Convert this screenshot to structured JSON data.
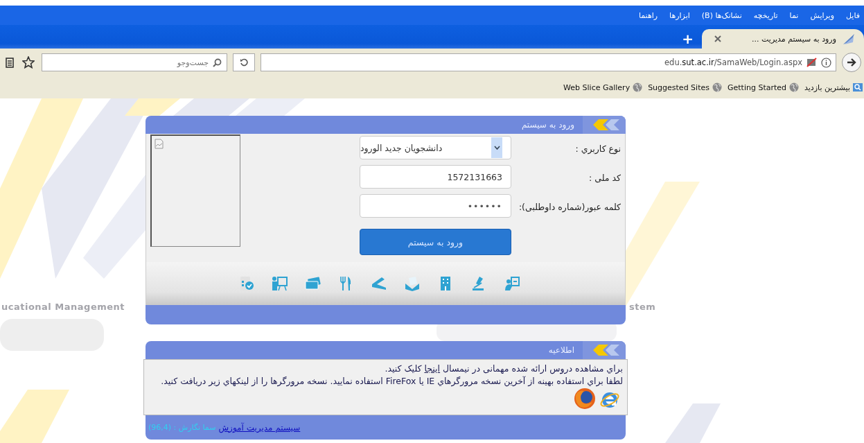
{
  "browser": {
    "menu": [
      "فایل",
      "ویرایش",
      "نما",
      "تاریخچه",
      "نشانک‌ها (B)",
      "ابزارها",
      "راهنما"
    ],
    "tabs": [
      {
        "title": "ورود به سیستم مدیریت ...",
        "selected": true
      }
    ],
    "new_tab": "+",
    "url": "edu.**sut.ac.ir**/SamaWeb/Login.aspx",
    "search": {
      "placeholder": "جست‌وجو"
    },
    "bookmarks": [
      {
        "label": "بیشترین بازدید",
        "kind": "folder"
      },
      {
        "label": "Getting Started",
        "kind": "site"
      },
      {
        "label": "Suggested Sites",
        "kind": "site"
      },
      {
        "label": "Web Slice Gallery",
        "kind": "site"
      }
    ]
  },
  "background": {
    "left_text": "ucational Management",
    "right_text": "stem"
  },
  "login": {
    "title": "ورود به سیستم",
    "fields": [
      {
        "kind": "select",
        "label": "نوع کاربري :",
        "value": "دانشجویان جدید الورود"
      },
      {
        "kind": "text",
        "label": "کد ملی :",
        "value": "1572131663"
      },
      {
        "kind": "password",
        "label": "کلمه عبور(شماره داوطلبی):",
        "value": "••••••"
      }
    ],
    "button": "ورود به سیستم"
  },
  "info": {
    "title": "اطلاعیه",
    "line1": "براي مشاهده دروس ارائه شده مهمانی در نیمسال ",
    "link": "اینجا",
    "line1_end": " کلیک کنید.",
    "line2": "لطفا براي استفاده بهينه از آخرين نسخه مرورگرهاي IE يا FireFox استفاده نماييد. نسخه مرورگرها را از لينکهاي زير دريافت کنيد.",
    "footer_link": "سیستم مدیریت آموزش",
    "footer_text": "سما نگارش : (96,4)"
  }
}
